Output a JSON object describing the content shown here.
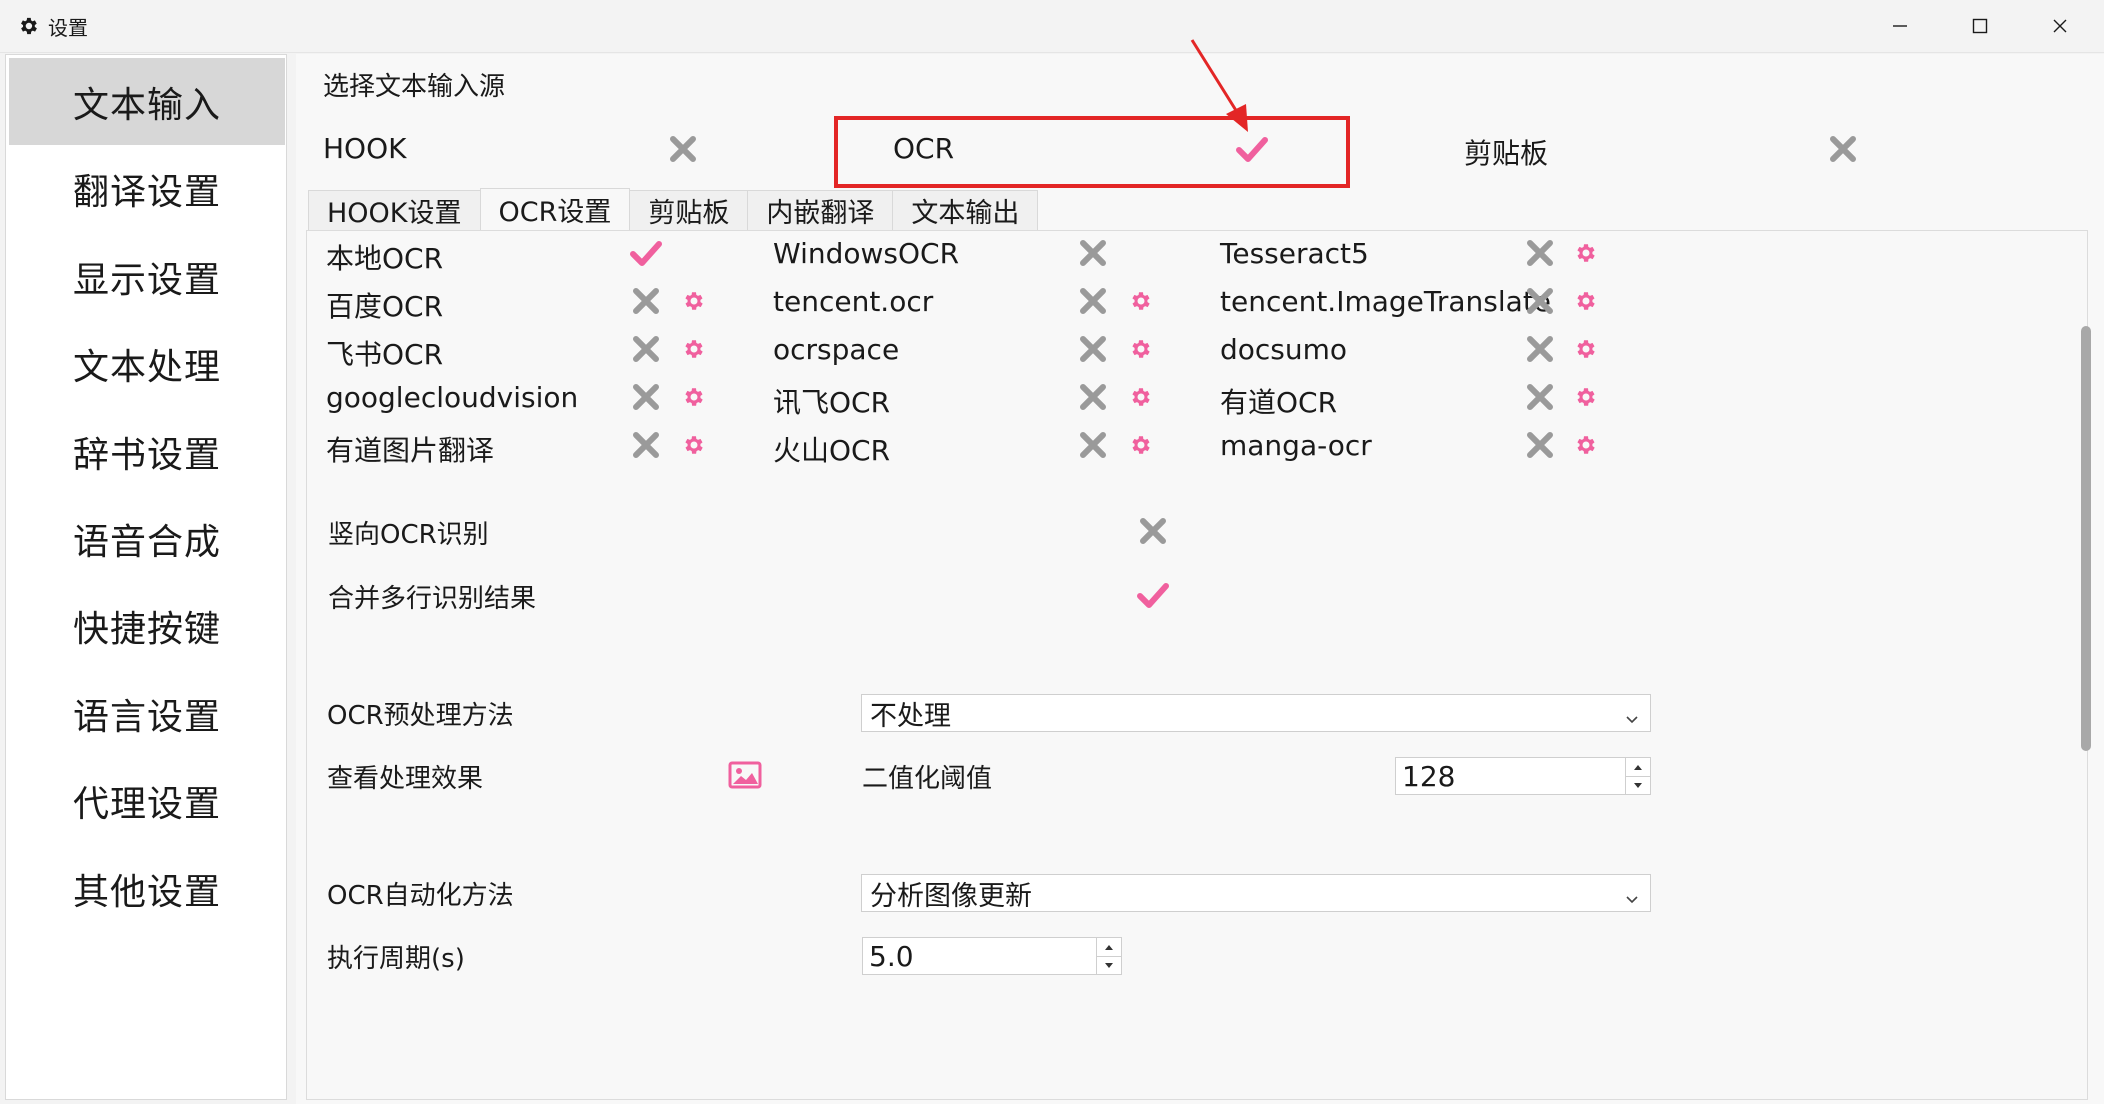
{
  "window": {
    "title": "设置",
    "icon": "gear-icon"
  },
  "sidebar": {
    "items": [
      {
        "label": "文本输入",
        "active": true
      },
      {
        "label": "翻译设置"
      },
      {
        "label": "显示设置"
      },
      {
        "label": "文本处理"
      },
      {
        "label": "辞书设置"
      },
      {
        "label": "语音合成"
      },
      {
        "label": "快捷按键"
      },
      {
        "label": "语言设置"
      },
      {
        "label": "代理设置"
      },
      {
        "label": "其他设置"
      }
    ]
  },
  "source": {
    "heading": "选择文本输入源",
    "options": [
      {
        "label": "HOOK",
        "state": "off"
      },
      {
        "label": "OCR",
        "state": "on"
      },
      {
        "label": "剪贴板",
        "state": "off"
      }
    ]
  },
  "tabs": [
    "HOOK设置",
    "OCR设置",
    "剪贴板",
    "内嵌翻译",
    "文本输出"
  ],
  "active_tab": "OCR设置",
  "engines": [
    {
      "label": "本地OCR",
      "state": "on",
      "settings": false
    },
    {
      "label": "WindowsOCR",
      "state": "off",
      "settings": false
    },
    {
      "label": "Tesseract5",
      "state": "off",
      "settings": true
    },
    {
      "label": "百度OCR",
      "state": "off",
      "settings": true
    },
    {
      "label": "tencent.ocr",
      "state": "off",
      "settings": true
    },
    {
      "label": "tencent.ImageTranslate",
      "state": "off",
      "settings": true
    },
    {
      "label": "飞书OCR",
      "state": "off",
      "settings": true
    },
    {
      "label": "ocrspace",
      "state": "off",
      "settings": true
    },
    {
      "label": "docsumo",
      "state": "off",
      "settings": true
    },
    {
      "label": "googlecloudvision",
      "state": "off",
      "settings": true
    },
    {
      "label": "讯飞OCR",
      "state": "off",
      "settings": true
    },
    {
      "label": "有道OCR",
      "state": "off",
      "settings": true
    },
    {
      "label": "有道图片翻译",
      "state": "off",
      "settings": true
    },
    {
      "label": "火山OCR",
      "state": "off",
      "settings": true
    },
    {
      "label": "manga-ocr",
      "state": "off",
      "settings": true
    }
  ],
  "options": {
    "vertical_ocr": {
      "label": "竖向OCR识别",
      "state": "off"
    },
    "merge_lines": {
      "label": "合并多行识别结果",
      "state": "on"
    },
    "preprocess": {
      "label": "OCR预处理方法",
      "value": "不处理"
    },
    "view_effect": {
      "label": "查看处理效果",
      "icon": "image-icon"
    },
    "threshold": {
      "label": "二值化阈值",
      "value": "128"
    },
    "auto_method": {
      "label": "OCR自动化方法",
      "value": "分析图像更新"
    },
    "period": {
      "label": "执行周期(s)",
      "value": "5.0"
    }
  },
  "colors": {
    "accent": "#f0609e",
    "off": "#9a9a9a",
    "highlight": "#e32626"
  }
}
